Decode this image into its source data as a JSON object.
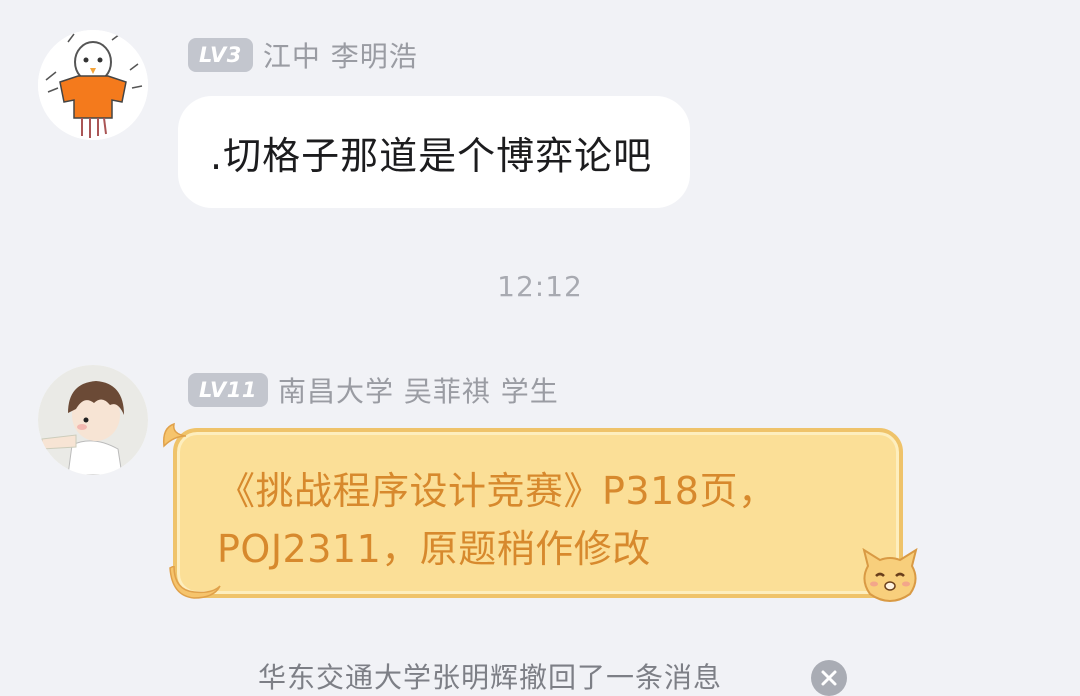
{
  "messages": [
    {
      "level": "LV3",
      "sender": "江中 李明浩",
      "text": ".切格子那道是个博弈论吧",
      "avatar_icon": "orange-shirt-bird-avatar"
    },
    {
      "level": "LV11",
      "sender": "南昌大学 吴菲祺 学生",
      "text_line1": "《挑战程序设计竞赛》P318页，",
      "text_line2": "POJ2311，原题稍作修改",
      "avatar_icon": "brown-hair-kid-avatar",
      "bubble_style": "orange-cat-bubble"
    }
  ],
  "timestamp": "12:12",
  "recall_notice": "华东交通大学张明辉撤回了一条消息",
  "colors": {
    "background": "#f1f2f6",
    "bubble_plain": "#ffffff",
    "bubble_fancy": "#fbdf97",
    "fancy_text": "#d7892d",
    "level_badge": "#c3c6ce"
  }
}
